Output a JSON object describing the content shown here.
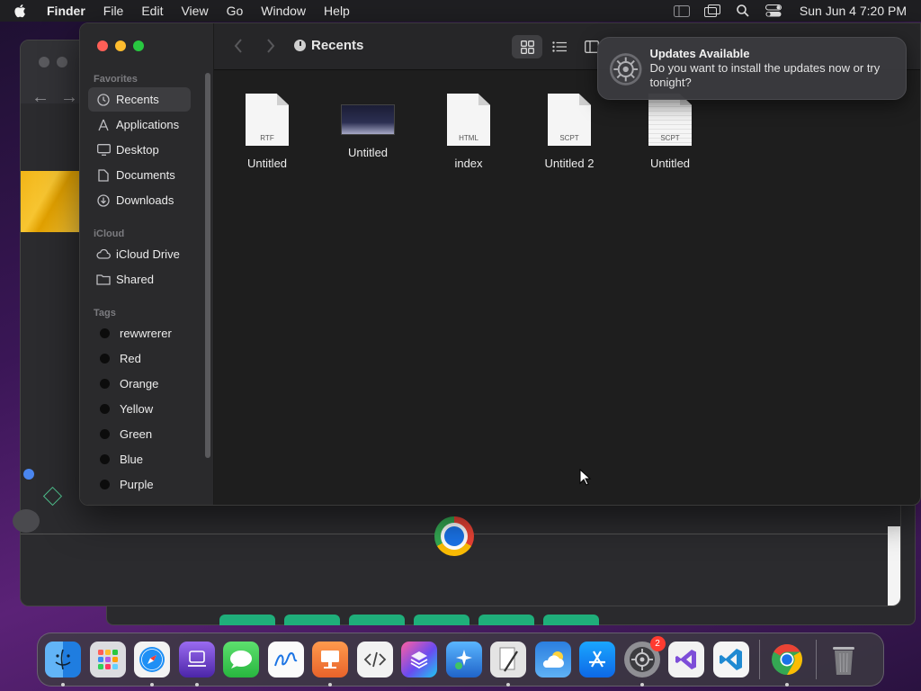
{
  "menubar": {
    "app_name": "Finder",
    "items": [
      "File",
      "Edit",
      "View",
      "Go",
      "Window",
      "Help"
    ],
    "clock": "Sun Jun 4  7:20 PM",
    "status_icons": [
      "sidebar-icon",
      "screen-mirroring-icon",
      "spotlight-search-icon",
      "control-center-icon"
    ]
  },
  "finder": {
    "title": "Recents",
    "sidebar": {
      "favorites_header": "Favorites",
      "favorites": [
        {
          "label": "Recents",
          "icon": "clock-icon"
        },
        {
          "label": "Applications",
          "icon": "applications-icon"
        },
        {
          "label": "Desktop",
          "icon": "desktop-icon"
        },
        {
          "label": "Documents",
          "icon": "document-icon"
        },
        {
          "label": "Downloads",
          "icon": "download-icon"
        }
      ],
      "icloud_header": "iCloud",
      "icloud": [
        {
          "label": "iCloud Drive",
          "icon": "cloud-icon"
        },
        {
          "label": "Shared",
          "icon": "shared-folder-icon"
        }
      ],
      "tags_header": "Tags",
      "tags": [
        "rewwrerer",
        "Red",
        "Orange",
        "Yellow",
        "Green",
        "Blue",
        "Purple"
      ]
    },
    "files": [
      {
        "name": "Untitled",
        "kind": "RTF"
      },
      {
        "name": "Untitled",
        "kind": "image"
      },
      {
        "name": "index",
        "kind": "HTML"
      },
      {
        "name": "Untitled 2",
        "kind": "SCPT"
      },
      {
        "name": "Untitled",
        "kind": "SCPT"
      }
    ]
  },
  "notification": {
    "title": "Updates Available",
    "body": "Do you want to install the updates now or try tonight?"
  },
  "dock": {
    "apps": [
      {
        "name": "Finder",
        "color": "#2f8cf2",
        "running": true
      },
      {
        "name": "Launchpad",
        "color": "#8a8f99",
        "running": false
      },
      {
        "name": "Safari",
        "color": "#2f8cf2",
        "running": true
      },
      {
        "name": "Apple Configurator",
        "color": "#6b3fc4",
        "running": true
      },
      {
        "name": "Messages",
        "color": "#35c759",
        "running": false
      },
      {
        "name": "Freeform",
        "color": "#f0f0f0",
        "running": false
      },
      {
        "name": "Keynote",
        "color": "#f07a3a",
        "running": true
      },
      {
        "name": "Script Editor",
        "color": "#e9e9e9",
        "running": false
      },
      {
        "name": "Shortcuts",
        "color": "#4a46c8",
        "running": false
      },
      {
        "name": "Feedback Assistant",
        "color": "#2a7fd4",
        "running": false
      },
      {
        "name": "Script Utility",
        "color": "#d9d9d9",
        "running": true
      },
      {
        "name": "Weather",
        "color": "#3a8fe8",
        "running": false
      },
      {
        "name": "App Store",
        "color": "#1e8ff5",
        "running": false
      },
      {
        "name": "System Settings",
        "color": "#8e8e93",
        "running": true,
        "badge": "2"
      },
      {
        "name": "Visual Studio",
        "color": "#7d4dd8",
        "running": false
      },
      {
        "name": "Visual Studio Code",
        "color": "#1f8ad2",
        "running": false
      },
      {
        "name": "Google Chrome",
        "color": "#ffffff",
        "running": true
      },
      {
        "name": "Trash",
        "color": "#7c7c80",
        "running": false
      }
    ]
  }
}
